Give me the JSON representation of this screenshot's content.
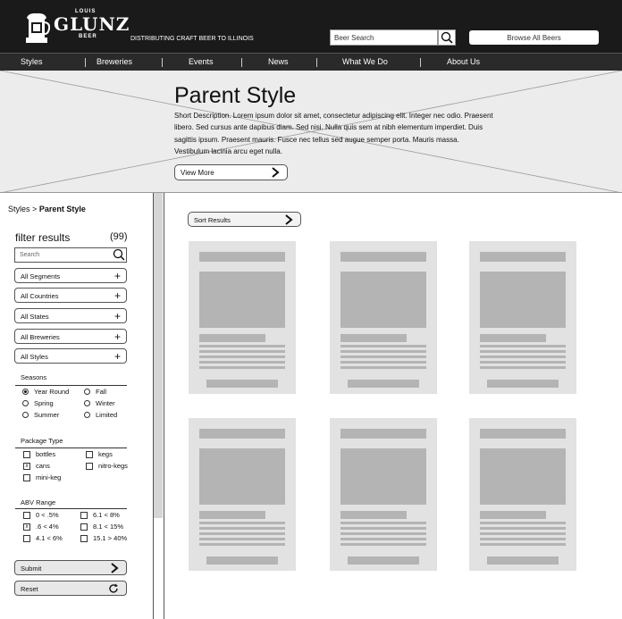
{
  "brand": {
    "top": "LOUIS",
    "name": "GLUNZ",
    "bottom": "BEER",
    "tagline": "DISTRIBUTING CRAFT BEER TO ILLINOIS"
  },
  "header": {
    "search_placeholder": "Beer Search",
    "browse_label": "Browse All Beers"
  },
  "nav": [
    "Styles",
    "Breweries",
    "Events",
    "News",
    "What We Do",
    "About Us"
  ],
  "hero": {
    "title": "Parent Style",
    "description": "Short Description. Lorem ipsum dolor sit amet, consectetur adipiscing elit. Integer nec odio. Praesent libero. Sed cursus ante dapibus diam. Sed nisi. Nulla quis sem at nibh elementum imperdiet. Duis sagittis ipsum. Praesent mauris. Fusce nec tellus sed augue semper porta. Mauris massa. Vestibulum lacinia arcu eget nulla.",
    "view_more": "View More"
  },
  "breadcrumb": {
    "root": "Styles",
    "sep": ">",
    "current": "Parent Style"
  },
  "filters": {
    "title": "filter results",
    "count": "(99)",
    "search_placeholder": "Search",
    "dropdowns": [
      "All Segments",
      "All Countries",
      "All States",
      "All Breweries",
      "All Styles"
    ],
    "seasons": {
      "label": "Seasons",
      "options": [
        {
          "label": "Year Round",
          "selected": true
        },
        {
          "label": "Fall",
          "selected": false
        },
        {
          "label": "Spring",
          "selected": false
        },
        {
          "label": "Winter",
          "selected": false
        },
        {
          "label": "Summer",
          "selected": false
        },
        {
          "label": "Limited",
          "selected": false
        }
      ]
    },
    "package": {
      "label": "Package Type",
      "options": [
        {
          "label": "bottles",
          "checked": false
        },
        {
          "label": "kegs",
          "checked": false
        },
        {
          "label": "cans",
          "checked": true
        },
        {
          "label": "nitro-kegs",
          "checked": false
        },
        {
          "label": "mini-keg",
          "checked": false
        }
      ]
    },
    "abv": {
      "label": "ABV Range",
      "options": [
        {
          "label": "0 < .5%",
          "checked": false
        },
        {
          "label": "6.1 < 8%",
          "checked": false
        },
        {
          "label": ".6 < 4%",
          "checked": true
        },
        {
          "label": "8.1 < 15%",
          "checked": false
        },
        {
          "label": "4.1 < 6%",
          "checked": false
        },
        {
          "label": "15.1 > 40%",
          "checked": false
        }
      ]
    },
    "submit": "Submit",
    "reset": "Reset"
  },
  "main": {
    "sort_label": "Sort Results",
    "card_count": 6
  },
  "colors": {
    "header_bg": "#1a1a1a",
    "nav_bg": "#2a2a2a",
    "hero_bg": "#ececec",
    "card_bg": "#e2e2e2",
    "card_block": "#b4b4b4"
  },
  "icons": [
    "beer-mug-logo-icon",
    "search-icon",
    "chevron-right-icon",
    "plus-icon",
    "reset-refresh-icon"
  ]
}
